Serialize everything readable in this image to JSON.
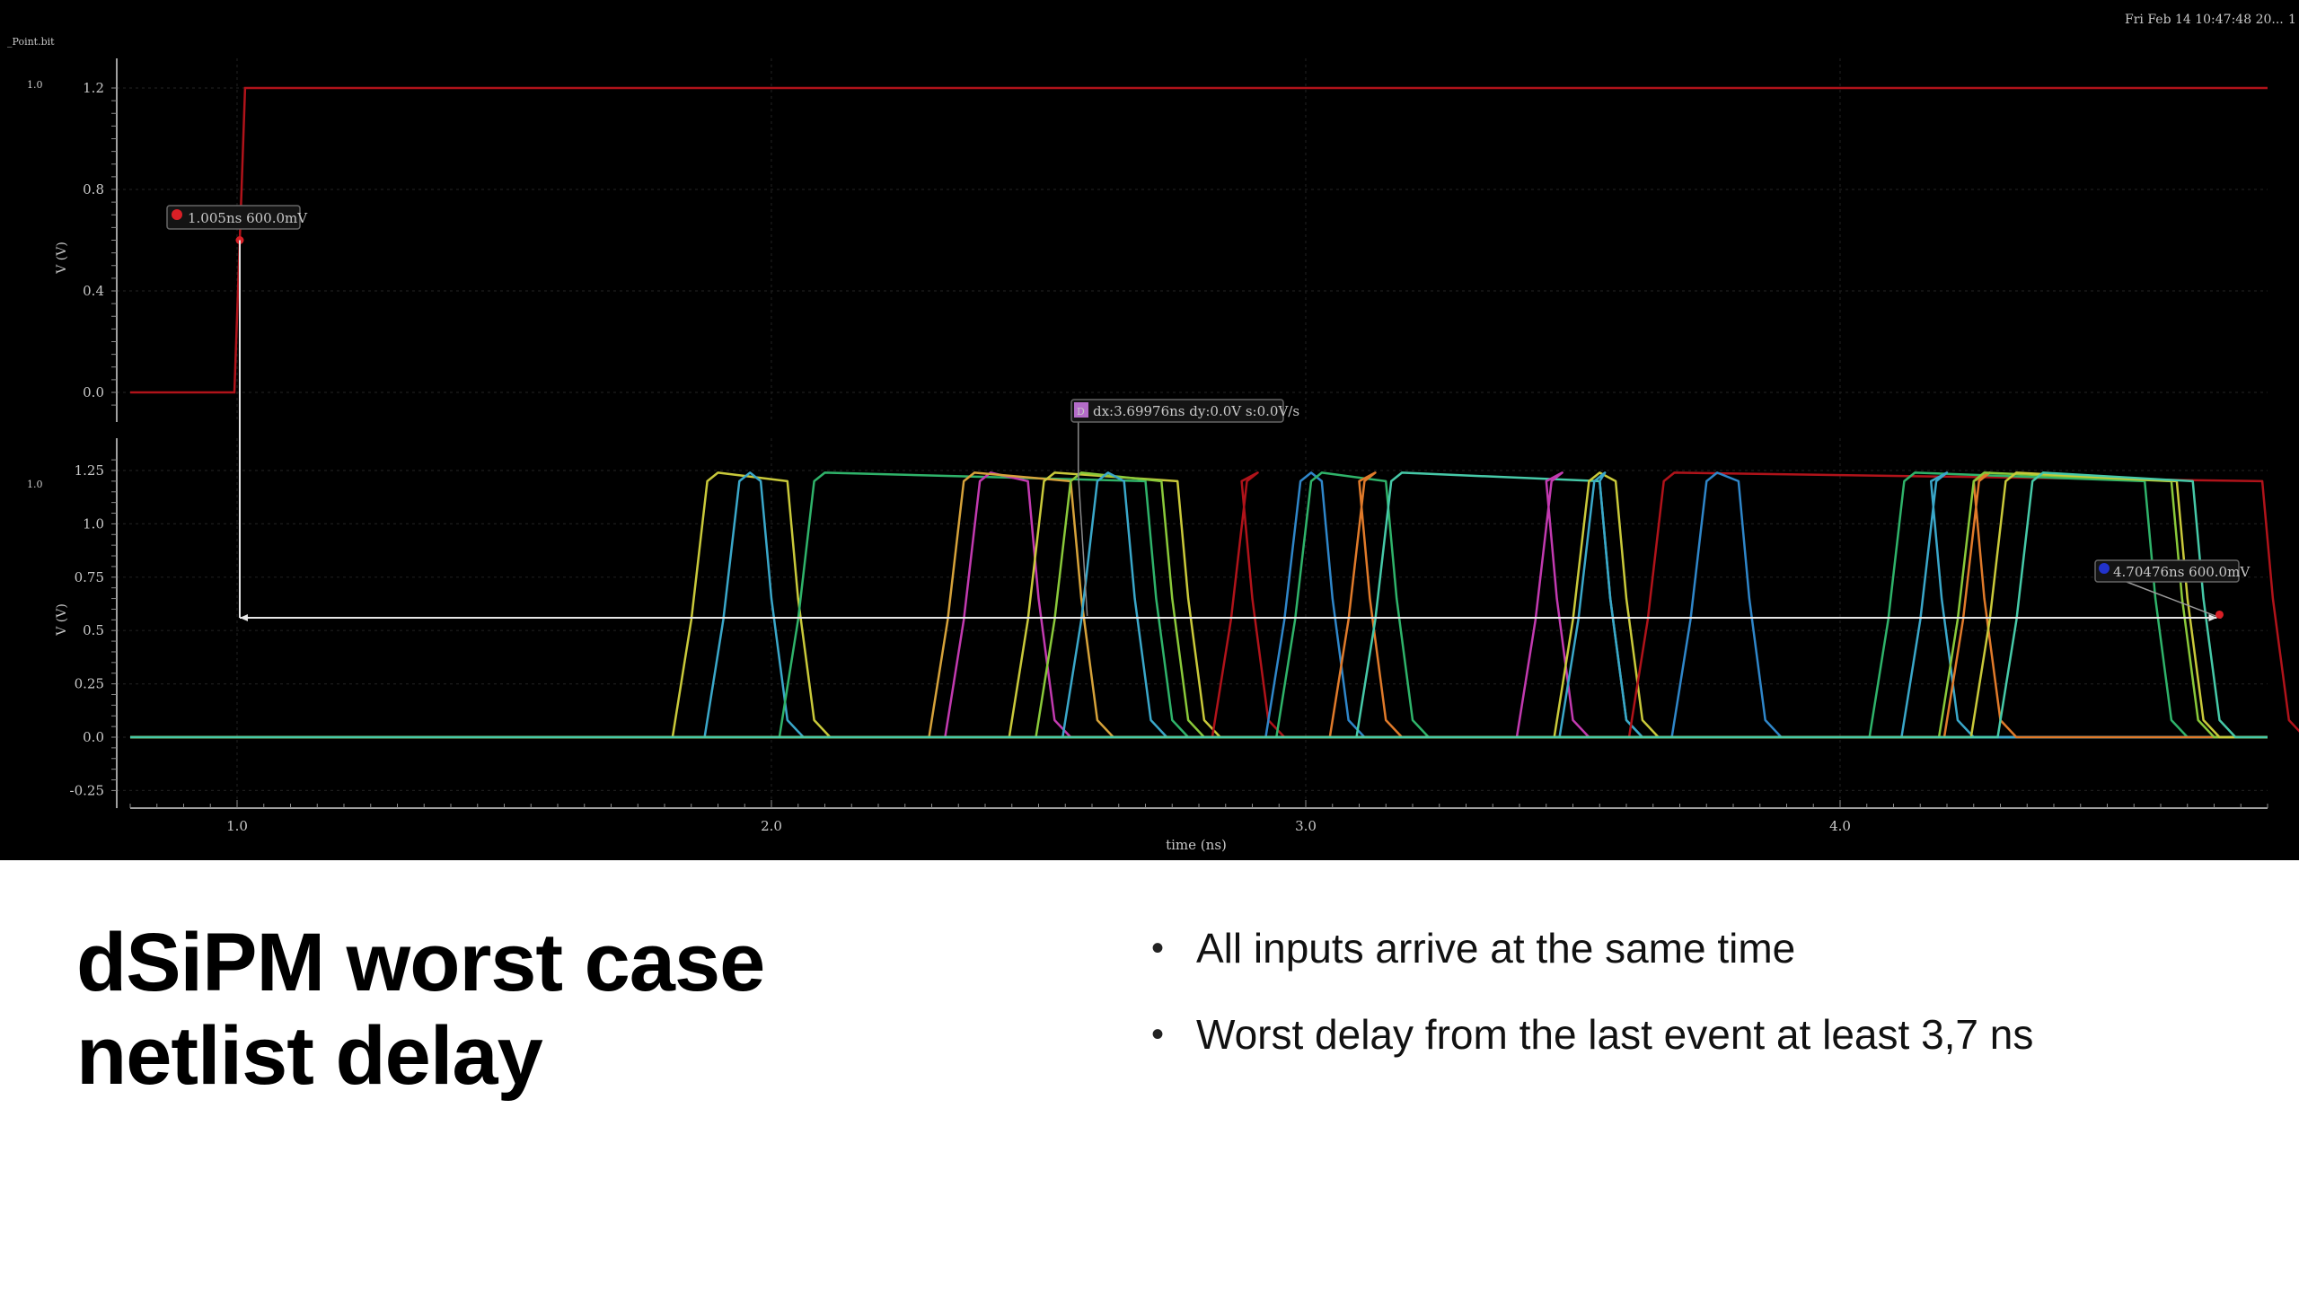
{
  "header": {
    "timestamp": "Fri Feb 14 10:47:48 20...",
    "right_edge": "1",
    "top_left_label": "_Point.bit"
  },
  "chart_data": [
    {
      "type": "line",
      "panel": "top",
      "ylabel": "V (V)",
      "corner_label": "1.0",
      "ylim": [
        -0.1,
        1.3
      ],
      "yticks": [
        {
          "label": "1.2",
          "value": 1.2
        },
        {
          "label": "0.8",
          "value": 0.8
        },
        {
          "label": "0.4",
          "value": 0.4
        },
        {
          "label": "0.0",
          "value": 0.0
        }
      ],
      "colors": {
        "reference": "#b0131a"
      },
      "series": [
        {
          "points": [
            [
              0.8,
              0.0
            ],
            [
              0.995,
              0.0
            ],
            [
              1.005,
              0.6
            ],
            [
              1.015,
              1.2
            ],
            [
              4.8,
              1.2
            ]
          ]
        }
      ],
      "marker": {
        "label": "1.005ns 600.0mV",
        "x": 1.005,
        "y": 0.6
      }
    },
    {
      "type": "line",
      "panel": "bottom",
      "ylabel": "V (V)",
      "corner_label": "1.0",
      "xlabel": "time (ns)",
      "xlim": [
        0.8,
        4.8
      ],
      "ylim": [
        -0.3,
        1.4
      ],
      "xticks": [
        {
          "label": "1.0",
          "value": 1.0
        },
        {
          "label": "2.0",
          "value": 2.0
        },
        {
          "label": "3.0",
          "value": 3.0
        },
        {
          "label": "4.0",
          "value": 4.0
        }
      ],
      "yticks": [
        {
          "label": "1.25",
          "value": 1.25
        },
        {
          "label": "1.0",
          "value": 1.0
        },
        {
          "label": "0.75",
          "value": 0.75
        },
        {
          "label": "0.5",
          "value": 0.5
        },
        {
          "label": "0.25",
          "value": 0.25
        },
        {
          "label": "0.0",
          "value": 0.0
        },
        {
          "label": "-0.25",
          "value": -0.25
        }
      ],
      "colors": {
        "palette": [
          "#c9c93a",
          "#3aa7c9",
          "#2fb36a",
          "#c23ab0",
          "#d6a23a",
          "#b0131a",
          "#2f86c9",
          "#8ac93a",
          "#e07a2a",
          "#46c9a8"
        ],
        "marker_a": "#d81f26",
        "marker_b": "#2233cc",
        "delta": "#b46cc8",
        "measure": "#e6e6e6"
      },
      "pulses": [
        {
          "color_index": 0,
          "start": 1.82,
          "end": 2.05
        },
        {
          "color_index": 1,
          "start": 1.88,
          "end": 2.0
        },
        {
          "color_index": 2,
          "start": 2.02,
          "end": 2.72
        },
        {
          "color_index": 3,
          "start": 2.33,
          "end": 2.5
        },
        {
          "color_index": 4,
          "start": 2.3,
          "end": 2.58
        },
        {
          "color_index": 0,
          "start": 2.45,
          "end": 2.78
        },
        {
          "color_index": 7,
          "start": 2.5,
          "end": 2.75
        },
        {
          "color_index": 1,
          "start": 2.55,
          "end": 2.68
        },
        {
          "color_index": 5,
          "start": 2.83,
          "end": 2.9
        },
        {
          "color_index": 6,
          "start": 2.93,
          "end": 3.05
        },
        {
          "color_index": 2,
          "start": 2.95,
          "end": 3.17
        },
        {
          "color_index": 8,
          "start": 3.05,
          "end": 3.12
        },
        {
          "color_index": 9,
          "start": 3.1,
          "end": 3.57
        },
        {
          "color_index": 3,
          "start": 3.4,
          "end": 3.47
        },
        {
          "color_index": 0,
          "start": 3.47,
          "end": 3.6
        },
        {
          "color_index": 1,
          "start": 3.48,
          "end": 3.57
        },
        {
          "color_index": 5,
          "start": 3.61,
          "end": 4.81
        },
        {
          "color_index": 6,
          "start": 3.69,
          "end": 3.83
        },
        {
          "color_index": 2,
          "start": 4.06,
          "end": 4.59
        },
        {
          "color_index": 1,
          "start": 4.12,
          "end": 4.19
        },
        {
          "color_index": 8,
          "start": 4.2,
          "end": 4.27
        },
        {
          "color_index": 7,
          "start": 4.19,
          "end": 4.64
        },
        {
          "color_index": 0,
          "start": 4.25,
          "end": 4.65
        },
        {
          "color_index": 9,
          "start": 4.3,
          "end": 4.68
        }
      ],
      "marker_a": {
        "x": 1.005,
        "y": 0.56
      },
      "marker_b": {
        "label": "4.70476ns 600.0mV",
        "x": 4.705,
        "y": 0.6
      },
      "delta": {
        "label": "dx:3.69976ns dy:0.0V s:0.0V/s",
        "badge": "D",
        "x": 2.86
      },
      "measure": {
        "x1": 1.005,
        "x2": 4.705,
        "y": 0.56
      }
    }
  ],
  "slide": {
    "title_lines": [
      "dSiPM worst case",
      "netlist delay"
    ],
    "bullets": [
      "All inputs arrive at the same time",
      "Worst delay from the last event at least 3,7 ns"
    ]
  }
}
